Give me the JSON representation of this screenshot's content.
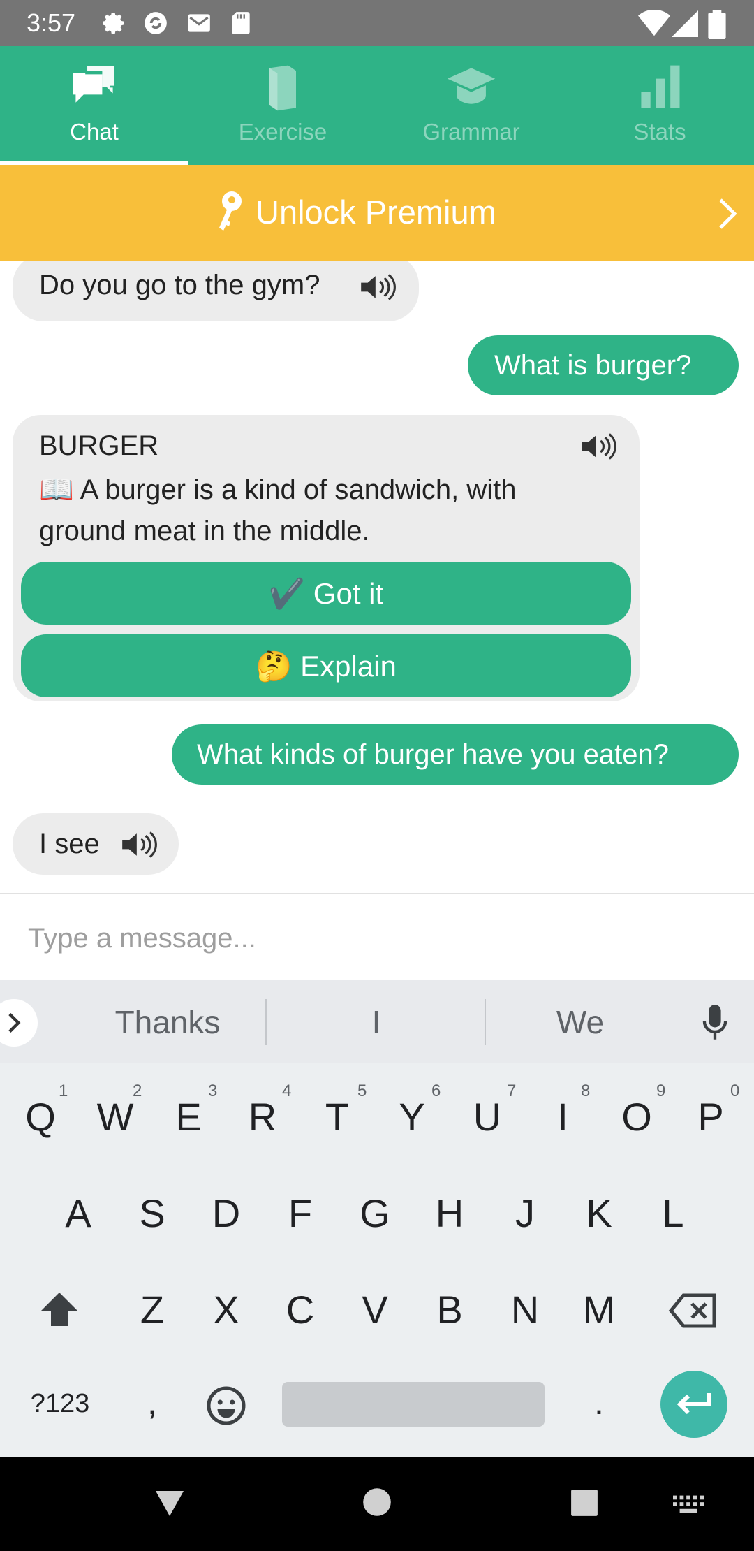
{
  "status_bar": {
    "time": "3:57"
  },
  "tabs": [
    {
      "label": "Chat",
      "active": true
    },
    {
      "label": "Exercise",
      "active": false
    },
    {
      "label": "Grammar",
      "active": false
    },
    {
      "label": "Stats",
      "active": false
    }
  ],
  "premium": {
    "label": "Unlock Premium"
  },
  "messages": {
    "m1": "Do you go to the gym?",
    "m2": "What is burger?",
    "card_title": "BURGER",
    "card_line1": "📖 A burger is a kind of sandwich, with",
    "card_line2": "ground meat in the middle.",
    "got_it": "✔️ Got it",
    "explain": "🤔 Explain",
    "m3": "What kinds of burger have you eaten?",
    "m4": "I see"
  },
  "input": {
    "placeholder": "Type a message..."
  },
  "keyboard": {
    "suggestions": [
      "Thanks",
      "I",
      "We"
    ],
    "row1": [
      "Q",
      "W",
      "E",
      "R",
      "T",
      "Y",
      "U",
      "I",
      "O",
      "P"
    ],
    "row1_hints": [
      "1",
      "2",
      "3",
      "4",
      "5",
      "6",
      "7",
      "8",
      "9",
      "0"
    ],
    "row2": [
      "A",
      "S",
      "D",
      "F",
      "G",
      "H",
      "J",
      "K",
      "L"
    ],
    "row3": [
      "Z",
      "X",
      "C",
      "V",
      "B",
      "N",
      "M"
    ],
    "symbols_label": "?123",
    "comma": ",",
    "period": "."
  },
  "colors": {
    "accent": "#2fb387",
    "premium": "#f8bf3a",
    "status_bar": "#757575"
  }
}
